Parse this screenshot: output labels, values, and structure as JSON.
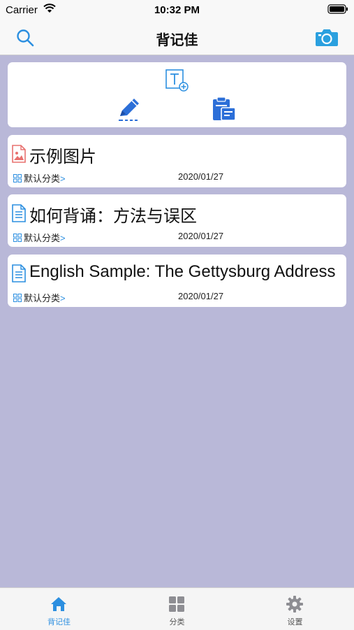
{
  "status": {
    "carrier": "Carrier",
    "time": "10:32 PM"
  },
  "nav": {
    "title": "背记佳"
  },
  "notes": [
    {
      "title": "示例图片",
      "category": "默认分类",
      "arrow": ">",
      "date": "2020/01/27",
      "icon": "image-file-icon"
    },
    {
      "title": "如何背诵：方法与误区",
      "category": "默认分类",
      "arrow": ">",
      "date": "2020/01/27",
      "icon": "document-icon"
    },
    {
      "title": "English Sample: The Gettysburg Address",
      "category": "默认分类",
      "arrow": ">",
      "date": "2020/01/27",
      "icon": "document-icon"
    }
  ],
  "tabs": [
    {
      "label": "背记佳",
      "icon": "home-icon",
      "active": true
    },
    {
      "label": "分类",
      "icon": "grid-icon",
      "active": false
    },
    {
      "label": "设置",
      "icon": "gear-icon",
      "active": false
    }
  ],
  "colors": {
    "accent": "#2c8fe0",
    "background": "#b9b8d8",
    "inactive": "#8e8e93",
    "image_icon": "#e8716f"
  }
}
